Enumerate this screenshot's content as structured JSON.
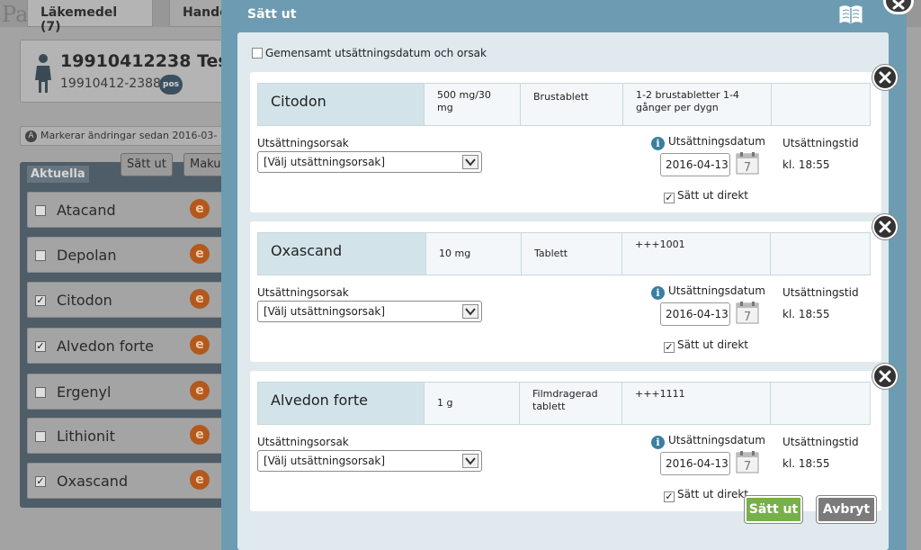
{
  "background": {
    "app_letters": "Pa",
    "tabs": [
      {
        "label": "Läkemedel (7)"
      },
      {
        "label": "Hande"
      }
    ],
    "patient": {
      "personnummer": "19910412238",
      "name_fragment": "Tes",
      "personnummer_short": "19910412-2388",
      "badge": "pos"
    },
    "change_note": "Markerar ändringar sedan 2016-03-",
    "change_note_badge": "A",
    "list_title": "Aktuella",
    "buttons": {
      "set_out": "Sätt ut",
      "cancel": "Maku"
    },
    "medications": [
      {
        "name": "Atacand",
        "checked": false
      },
      {
        "name": "Depolan",
        "checked": false
      },
      {
        "name": "Citodon",
        "checked": true
      },
      {
        "name": "Alvedon forte",
        "checked": true
      },
      {
        "name": "Ergenyl",
        "checked": false
      },
      {
        "name": "Lithionit",
        "checked": false
      },
      {
        "name": "Oxascand",
        "checked": true
      }
    ],
    "item_badge": "e"
  },
  "modal": {
    "title": "Sätt ut",
    "common_label": "Gemensamt utsättningsdatum och orsak",
    "labels": {
      "reason": "Utsättningsorsak",
      "date": "Utsättningsdatum",
      "time": "Utsättningstid",
      "direct": "Sätt ut direkt",
      "info_glyph": "i",
      "calendar_day": "7"
    },
    "cards": [
      {
        "name": "Citodon",
        "strength": "500 mg/30 mg",
        "form": "Brustablett",
        "dosage": "1-2 brustabletter 1-4 gånger per dygn",
        "reason_value": "[Välj utsättningsorsak]",
        "date": "2016-04-13",
        "time": "kl. 18:55",
        "direct_checked": true
      },
      {
        "name": "Oxascand",
        "strength": "10 mg",
        "form": "Tablett",
        "dosage": "+++1001",
        "reason_value": "[Välj utsättningsorsak]",
        "date": "2016-04-13",
        "time": "kl. 18:55",
        "direct_checked": true
      },
      {
        "name": "Alvedon forte",
        "strength": "1 g",
        "form": "Filmdragerad tablett",
        "dosage": "+++1111",
        "reason_value": "[Välj utsättningsorsak]",
        "date": "2016-04-13",
        "time": "kl. 18:55",
        "direct_checked": true
      }
    ],
    "buttons": {
      "submit": "Sätt ut",
      "cancel": "Avbryt"
    }
  },
  "colors": {
    "modal": "#6d9cb2",
    "primary_button": "#77b04a",
    "close": "#333333"
  }
}
